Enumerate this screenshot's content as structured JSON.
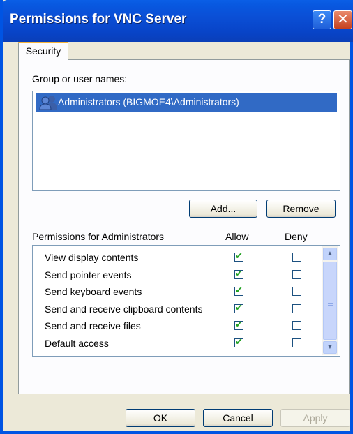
{
  "window": {
    "title": "Permissions for VNC Server",
    "help_glyph": "?",
    "close_glyph": "✕"
  },
  "tabs": [
    {
      "label": "Security"
    }
  ],
  "group_section": {
    "label": "Group or user names:",
    "users": [
      {
        "name": "Administrators (BIGMOE4\\Administrators)",
        "selected": true
      }
    ],
    "add_button": "Add...",
    "remove_button": "Remove"
  },
  "permissions": {
    "header": "Permissions for Administrators",
    "allow_header": "Allow",
    "deny_header": "Deny",
    "rows": [
      {
        "name": "View display contents",
        "allow": true,
        "deny": false
      },
      {
        "name": "Send pointer events",
        "allow": true,
        "deny": false
      },
      {
        "name": "Send keyboard events",
        "allow": true,
        "deny": false
      },
      {
        "name": "Send and receive clipboard contents",
        "allow": true,
        "deny": false
      },
      {
        "name": "Send and receive files",
        "allow": true,
        "deny": false
      },
      {
        "name": "Default access",
        "allow": true,
        "deny": false
      }
    ]
  },
  "footer": {
    "ok": "OK",
    "cancel": "Cancel",
    "apply": "Apply"
  },
  "icons": {
    "check_glyph": "✔",
    "scroll_up": "▲",
    "scroll_down": "▼"
  },
  "colors": {
    "title_blue": "#0a4fd6",
    "selection": "#316ac5",
    "dialog_bg": "#ece9d8",
    "tab_accent": "#f7b53c"
  }
}
